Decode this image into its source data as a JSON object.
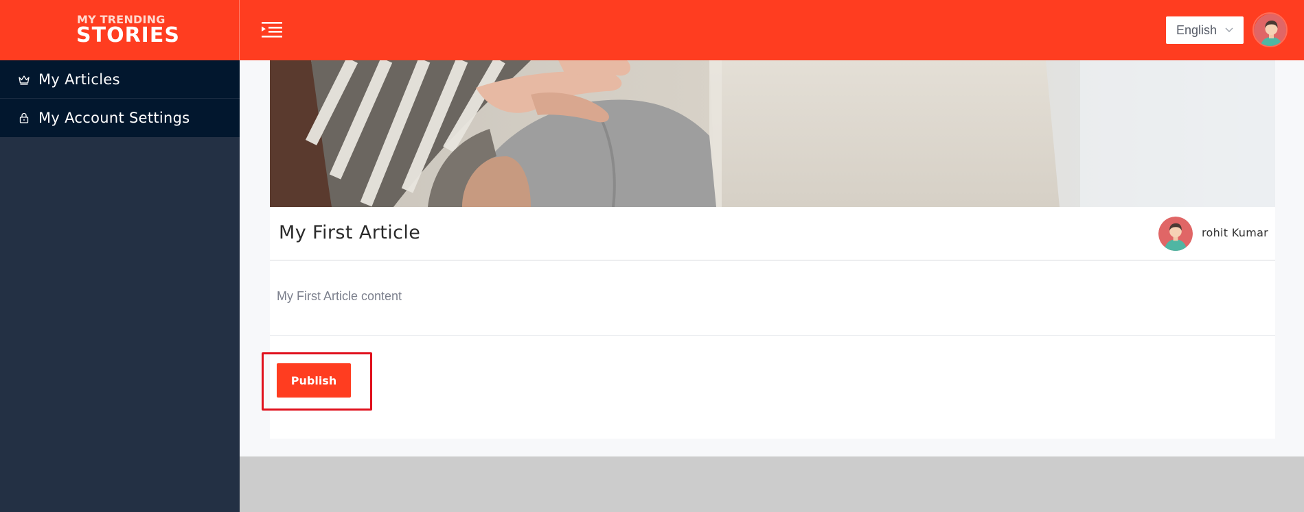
{
  "header": {
    "brand_small": "MY TRENDING",
    "brand_big": "STORIES",
    "menu_icon": "menu-toggle-icon",
    "language": {
      "selected": "English"
    },
    "accent_color": "#ff3d20"
  },
  "sidebar": {
    "items": [
      {
        "label": "My Articles",
        "icon": "crown-icon"
      },
      {
        "label": "My Account Settings",
        "icon": "lock-icon"
      }
    ]
  },
  "article": {
    "title": "My First Article",
    "author": "rohit Kumar",
    "content": "My First Article content",
    "publish_label": "Publish"
  }
}
